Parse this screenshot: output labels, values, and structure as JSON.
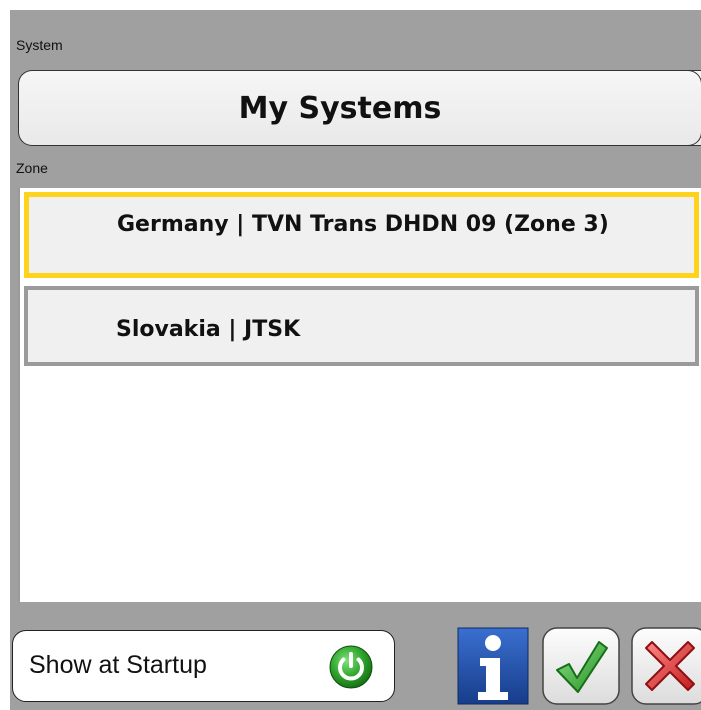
{
  "system": {
    "label": "System",
    "selected_label": "My Systems"
  },
  "zone": {
    "label": "Zone",
    "items": [
      {
        "label": "Germany | TVN Trans DHDN 09 (Zone 3)",
        "selected": true
      },
      {
        "label": "Slovakia | JTSK",
        "selected": false
      }
    ]
  },
  "footer": {
    "startup_label": "Show at Startup",
    "startup_icon": "power-icon",
    "info_icon": "info-icon",
    "ok_icon": "checkmark-icon",
    "cancel_icon": "close-icon"
  },
  "colors": {
    "panel_bg": "#a0a0a0",
    "selected_border": "#ffd21c",
    "power_green": "#2fa52c",
    "info_blue": "#1f4fa8",
    "ok_green": "#3cb43c",
    "cancel_red": "#d8282a"
  }
}
